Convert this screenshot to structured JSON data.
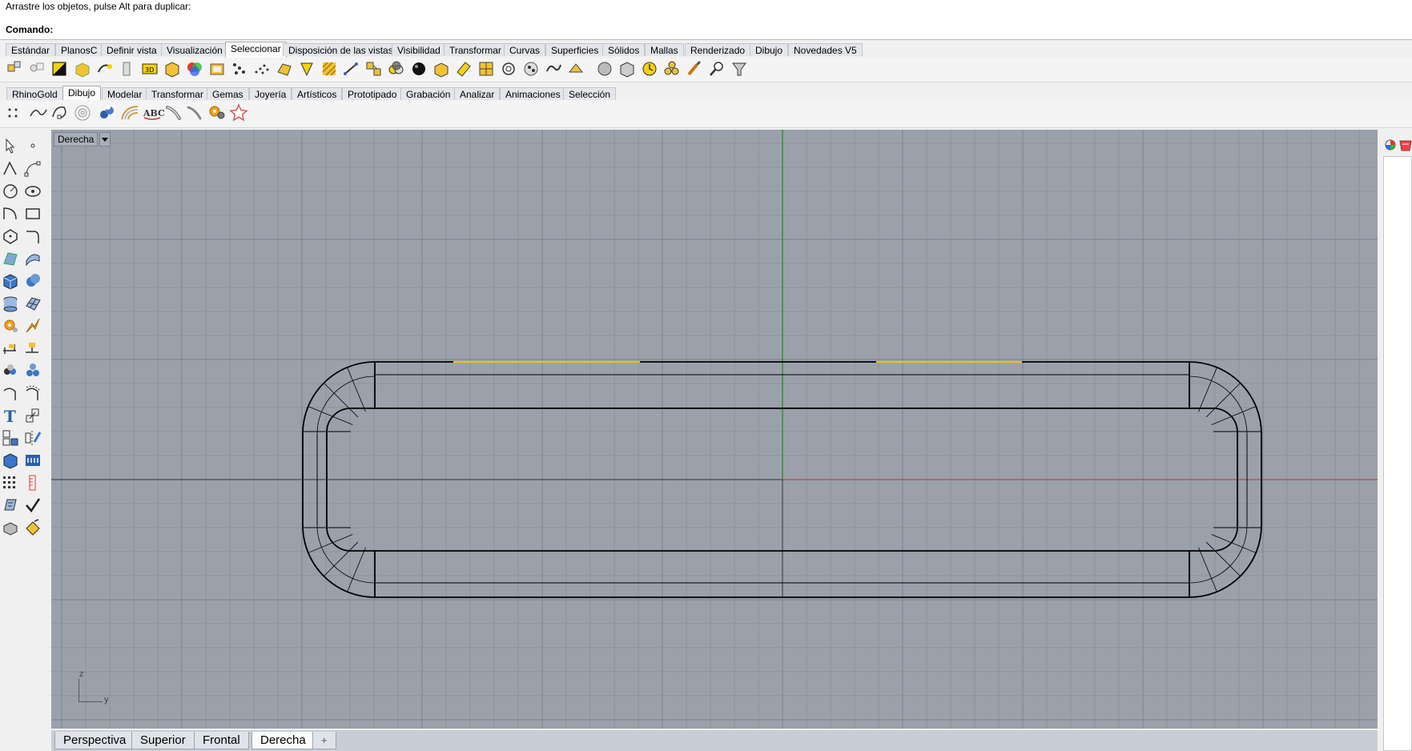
{
  "command": {
    "history": "Arrastre los objetos, pulse Alt para duplicar:",
    "prompt": "Comando:"
  },
  "toolbar_tabs_main": [
    {
      "label": "Estándar"
    },
    {
      "label": "PlanosC"
    },
    {
      "label": "Definir vista"
    },
    {
      "label": "Visualización"
    },
    {
      "label": "Seleccionar",
      "active": true
    },
    {
      "label": "Disposición de las vistas"
    },
    {
      "label": "Visibilidad"
    },
    {
      "label": "Transformar"
    },
    {
      "label": "Curvas"
    },
    {
      "label": "Superficies"
    },
    {
      "label": "Sólidos"
    },
    {
      "label": "Mallas"
    },
    {
      "label": "Renderizado"
    },
    {
      "label": "Dibujo"
    },
    {
      "label": "Novedades V5"
    }
  ],
  "toolbar_tabs_plugin": [
    {
      "label": "RhinoGold"
    },
    {
      "label": "Dibujo",
      "active": true
    },
    {
      "label": "Modelar"
    },
    {
      "label": "Transformar"
    },
    {
      "label": "Gemas"
    },
    {
      "label": "Joyería"
    },
    {
      "label": "Artísticos"
    },
    {
      "label": "Prototipado"
    },
    {
      "label": "Grabación"
    },
    {
      "label": "Analizar"
    },
    {
      "label": "Animaciones"
    },
    {
      "label": "Selección"
    }
  ],
  "viewport": {
    "name": "Derecha",
    "axis_z": "z",
    "axis_y": "y"
  },
  "view_tabs": [
    {
      "label": "Perspectiva"
    },
    {
      "label": "Superior"
    },
    {
      "label": "Frontal"
    },
    {
      "label": "Derecha",
      "active": true
    },
    {
      "label": "+"
    }
  ],
  "colors": {
    "viewport_bg": "#9aa1ab",
    "grid_minor": "#8c939d",
    "grid_major": "#7b828c",
    "axis_green": "#2a8a2a",
    "axis_red": "#b14a4a",
    "selection_yellow": "#e6c21c"
  }
}
